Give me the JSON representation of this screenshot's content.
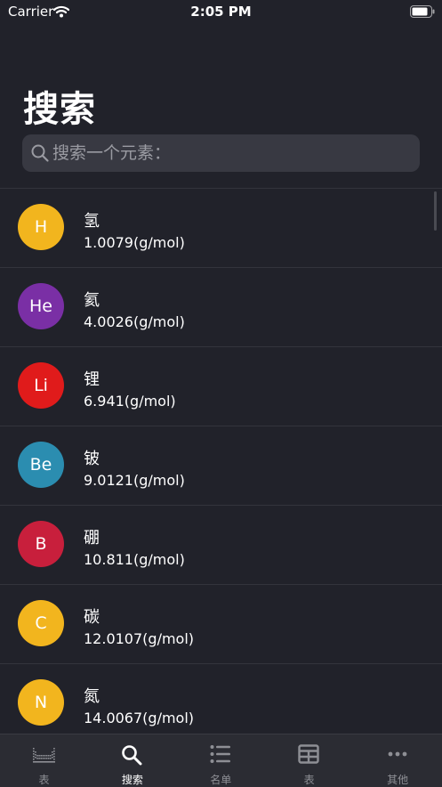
{
  "status_bar": {
    "carrier": "Carrier",
    "time": "2:05 PM"
  },
  "page": {
    "title": "搜索"
  },
  "search": {
    "placeholder": "搜索一个元素："
  },
  "elements": [
    {
      "symbol": "H",
      "name": "氢",
      "mass": "1.0079(g/mol)",
      "color": "#f2b51e"
    },
    {
      "symbol": "He",
      "name": "氦",
      "mass": "4.0026(g/mol)",
      "color": "#7a2fa5"
    },
    {
      "symbol": "Li",
      "name": "锂",
      "mass": "6.941(g/mol)",
      "color": "#e01b1b"
    },
    {
      "symbol": "Be",
      "name": "铍",
      "mass": "9.0121(g/mol)",
      "color": "#2b8db0"
    },
    {
      "symbol": "B",
      "name": "硼",
      "mass": "10.811(g/mol)",
      "color": "#c81f3c"
    },
    {
      "symbol": "C",
      "name": "碳",
      "mass": "12.0107(g/mol)",
      "color": "#f2b51e"
    },
    {
      "symbol": "N",
      "name": "氮",
      "mass": "14.0067(g/mol)",
      "color": "#f2b51e"
    }
  ],
  "tabs": [
    {
      "label": "表",
      "icon": "periodic-grid-icon",
      "active": false
    },
    {
      "label": "搜索",
      "icon": "search-icon",
      "active": true
    },
    {
      "label": "名单",
      "icon": "list-icon",
      "active": false
    },
    {
      "label": "表",
      "icon": "table-icon",
      "active": false
    },
    {
      "label": "其他",
      "icon": "more-icon",
      "active": false
    }
  ]
}
